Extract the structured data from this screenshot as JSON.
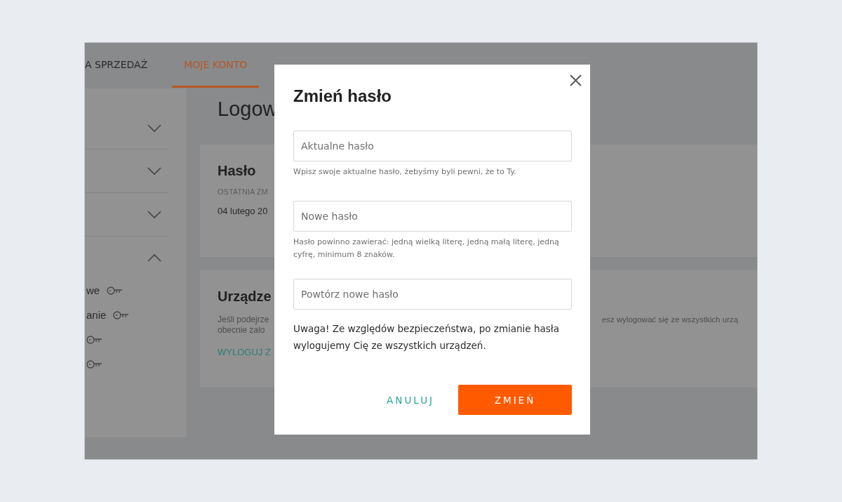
{
  "nav": {
    "tabs": [
      {
        "label": "A SPRZEDAŻ",
        "selected": false
      },
      {
        "label": "MOJE KONTO",
        "selected": true
      }
    ]
  },
  "sidebar": {
    "sections": [
      {
        "expanded": false
      },
      {
        "expanded": false
      },
      {
        "expanded": false
      },
      {
        "expanded": true,
        "items": [
          {
            "kind": "labeled",
            "label": "we"
          },
          {
            "kind": "labeled",
            "label": "anie"
          },
          {
            "kind": "icon-only"
          },
          {
            "kind": "icon-only"
          }
        ]
      }
    ]
  },
  "main": {
    "heading": "Logow",
    "cards": [
      {
        "title": "Hasło",
        "caption": "OSTATNIA ZM",
        "value": "04 lutego 20"
      },
      {
        "title": "Urządze",
        "text_lines": [
          "Jeśli podejrze",
          "obecnie zalo"
        ],
        "text_right": "esz wylogować się ze wszystkich urzą",
        "link": "WYLOGUJ Z"
      }
    ]
  },
  "dialog": {
    "title": "Zmień hasło",
    "fields": [
      {
        "placeholder": "Aktualne hasło",
        "hint": "Wpisz swoje aktualne hasło, żebyśmy byli pewni, że to Ty."
      },
      {
        "placeholder": "Nowe hasło",
        "hint": "Hasło powinno zawierać: jedną wielką literę, jedną małą literę, jedną cyfrę, minimum 8 znaków."
      },
      {
        "placeholder": "Powtórz nowe hasło"
      }
    ],
    "notice": "Uwaga! Ze względów bezpieczeństwa, po zmianie hasła wylogujemy Cię ze wszystkich urządzeń.",
    "buttons": [
      {
        "label": "ANULUJ",
        "kind": "secondary"
      },
      {
        "label": "ZMIEŃ",
        "kind": "primary"
      }
    ]
  }
}
